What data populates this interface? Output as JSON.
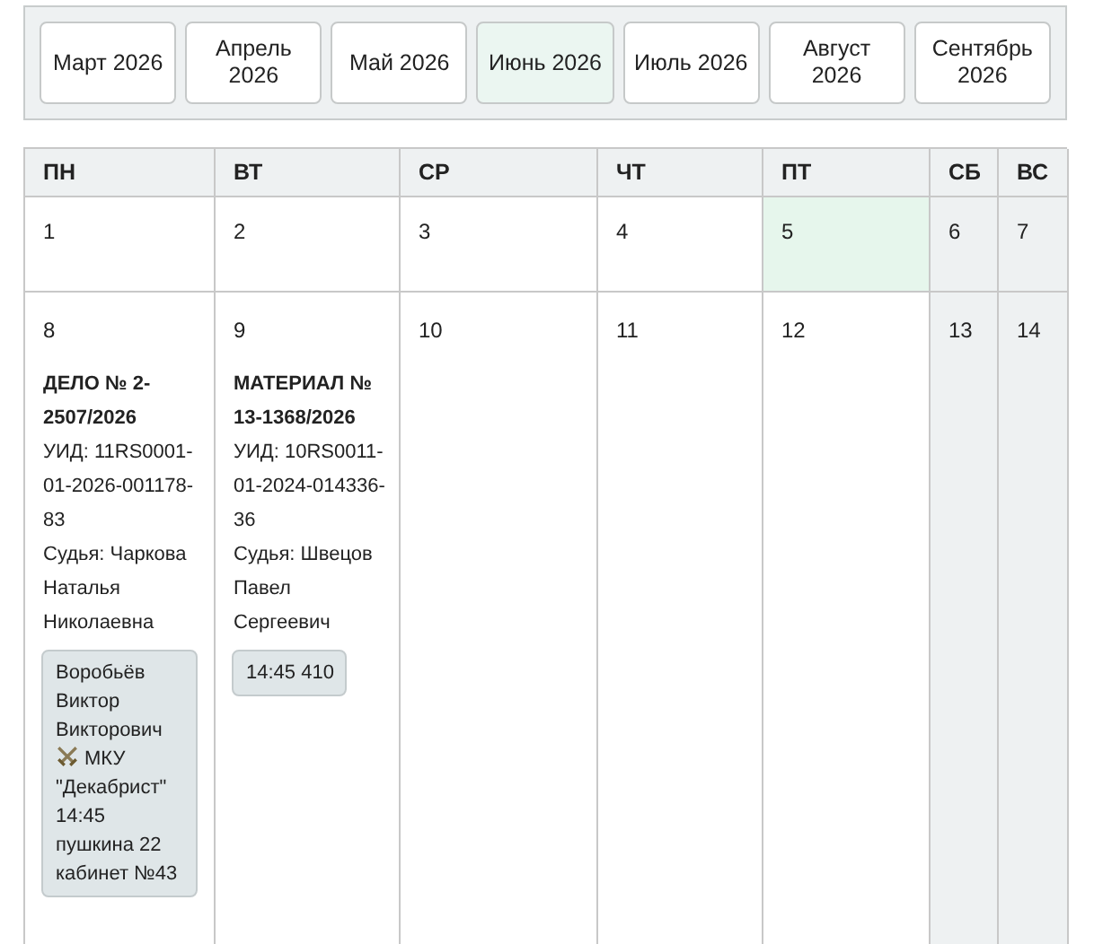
{
  "months": [
    {
      "label": "Март 2026",
      "selected": false
    },
    {
      "label": "Апрель 2026",
      "selected": false
    },
    {
      "label": "Май 2026",
      "selected": false
    },
    {
      "label": "Июнь 2026",
      "selected": true
    },
    {
      "label": "Июль 2026",
      "selected": false
    },
    {
      "label": "Август 2026",
      "selected": false
    },
    {
      "label": "Сентябрь 2026",
      "selected": false
    }
  ],
  "calendar": {
    "weekdays": [
      {
        "label": "ПН"
      },
      {
        "label": "ВТ"
      },
      {
        "label": "СР"
      },
      {
        "label": "ЧТ"
      },
      {
        "label": "ПТ"
      },
      {
        "label": "СБ"
      },
      {
        "label": "ВС"
      }
    ],
    "weeks": [
      [
        {
          "day": "1",
          "kind": "weekday",
          "today": false
        },
        {
          "day": "2",
          "kind": "weekday",
          "today": false
        },
        {
          "day": "3",
          "kind": "weekday",
          "today": false
        },
        {
          "day": "4",
          "kind": "weekday",
          "today": false
        },
        {
          "day": "5",
          "kind": "weekday",
          "today": true
        },
        {
          "day": "6",
          "kind": "weekend"
        },
        {
          "day": "7",
          "kind": "weekend"
        }
      ],
      [
        {
          "day": "8",
          "kind": "weekday",
          "today": false,
          "events": [
            {
              "title": "ДЕЛО № 2-2507/2026",
              "uid": "УИД: 11RS0001-01-2026-001178-83",
              "judge": "Судья: Чаркова Наталья Николаевна",
              "note": [
                {
                  "kind": "text",
                  "text": "Воробьёв Виктор Викторович"
                },
                {
                  "kind": "icon"
                },
                {
                  "kind": "text",
                  "text": "МКУ"
                },
                {
                  "kind": "text",
                  "text": "\"Декабрист\" 14:45 пушкина 22 кабинет №43"
                }
              ]
            }
          ]
        },
        {
          "day": "9",
          "kind": "weekday",
          "today": false,
          "events": [
            {
              "title": "МАТЕРИАЛ № 13-1368/2026",
              "uid": "УИД: 10RS0011-01-2024-014336-36",
              "judge": "Судья: Швецов Павел Сергеевич",
              "note": [
                {
                  "kind": "text",
                  "text": "14:45 410"
                }
              ]
            }
          ]
        },
        {
          "day": "10",
          "kind": "weekday",
          "today": false
        },
        {
          "day": "11",
          "kind": "weekday",
          "today": false
        },
        {
          "day": "12",
          "kind": "weekday",
          "today": false
        },
        {
          "day": "13",
          "kind": "weekend"
        },
        {
          "day": "14",
          "kind": "weekend"
        }
      ]
    ]
  }
}
